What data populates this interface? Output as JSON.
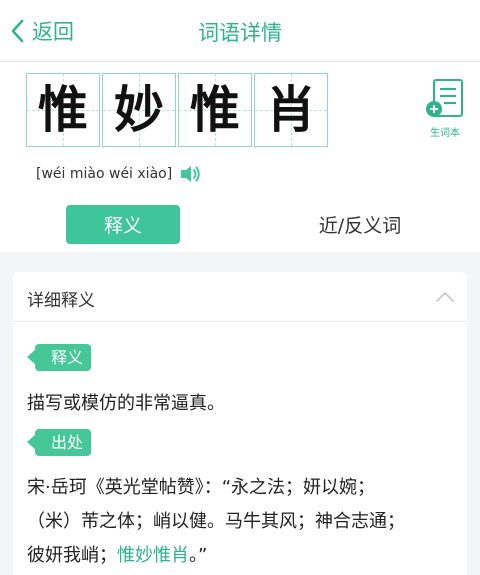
{
  "nav": {
    "back_label": "返回",
    "title": "词语详情"
  },
  "word": {
    "chars": [
      "惟",
      "妙",
      "惟",
      "肖"
    ],
    "pinyin": "[wéi miào wéi xiào]"
  },
  "vocab_button": {
    "label": "生词本",
    "icon": "add-note-icon"
  },
  "speaker_icon": "speaker-icon",
  "tabs": {
    "definition": "释义",
    "synonyms": "近/反义词"
  },
  "detail": {
    "header": "详细释义",
    "definition_tag": "释义",
    "definition_text": "描写或模仿的非常逼真。",
    "source_tag": "出处",
    "source_line1": "宋·岳珂《英光堂帖赞》：“永之法；妍以婉；",
    "source_line2": "（米）芾之体；峭以健。马牛其风；神合志通；",
    "source_line3_before": "彼妍我峭；",
    "source_line3_highlight": "惟妙惟肖",
    "source_line3_after": "。”"
  },
  "colors": {
    "accent": "#2bb58e",
    "tag": "#45c799",
    "tile_border": "#8fd9bd",
    "background": "#f4f5f7"
  }
}
